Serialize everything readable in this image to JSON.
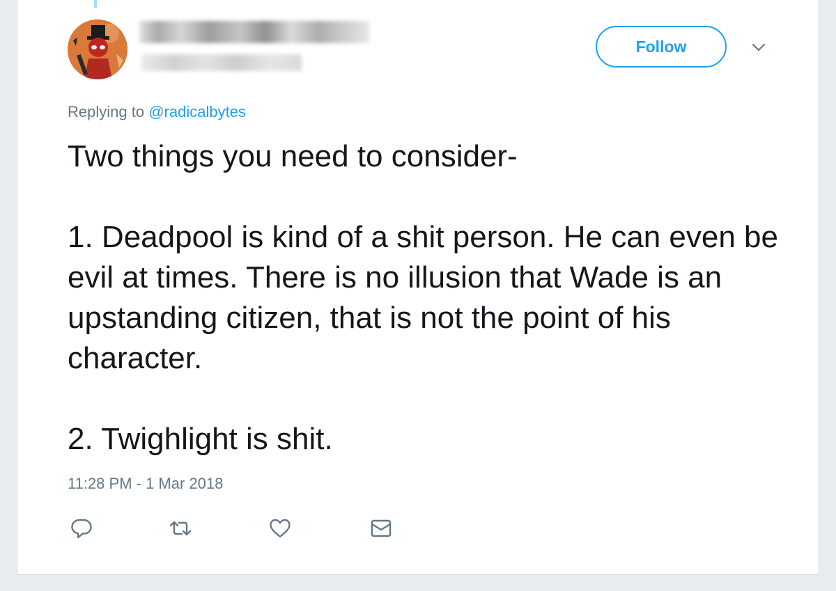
{
  "tweet": {
    "follow_label": "Follow",
    "replying_prefix": "Replying to",
    "replying_handle": "@radicalbytes",
    "text_paragraphs": [
      "Two things you need to consider-",
      "1. Deadpool is kind of a shit person. He can even be evil at times. There is no illusion that Wade is an upstanding citizen, that is not the point of his character.",
      "2. Twighlight is shit."
    ],
    "timestamp": "11:28 PM - 1 Mar 2018"
  },
  "icons": {
    "reply": "reply-icon",
    "retweet": "retweet-icon",
    "like": "heart-icon",
    "dm": "envelope-icon",
    "menu": "chevron-down-icon"
  },
  "colors": {
    "accent": "#1da1f2",
    "text": "#14171a",
    "secondary": "#657786",
    "icon": "#657786"
  }
}
